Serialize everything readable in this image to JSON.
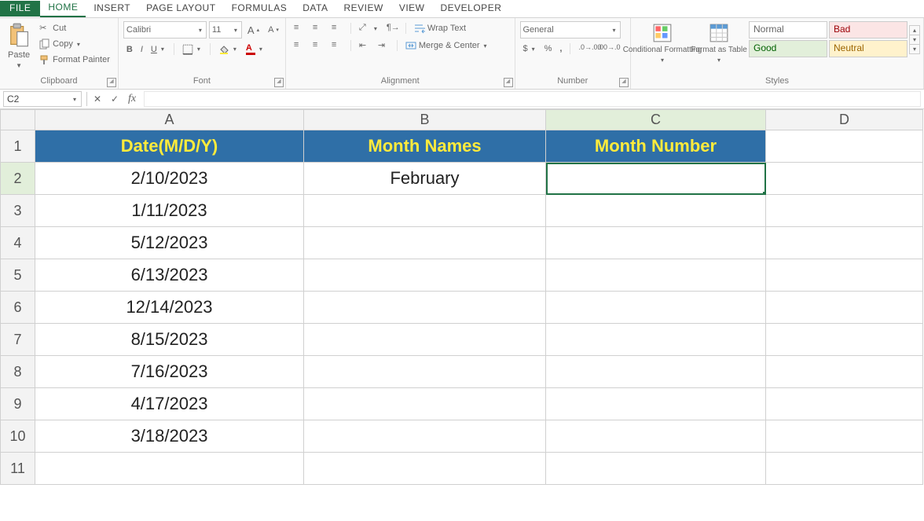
{
  "menu": {
    "file": "FILE",
    "home": "HOME",
    "insert": "INSERT",
    "page_layout": "PAGE LAYOUT",
    "formulas": "FORMULAS",
    "data": "DATA",
    "review": "REVIEW",
    "view": "VIEW",
    "developer": "DEVELOPER"
  },
  "ribbon": {
    "clipboard": {
      "paste": "Paste",
      "cut": "Cut",
      "copy": "Copy",
      "format_painter": "Format Painter",
      "label": "Clipboard"
    },
    "font": {
      "name": "Calibri",
      "size": "11",
      "label": "Font"
    },
    "alignment": {
      "wrap": "Wrap Text",
      "merge": "Merge & Center",
      "label": "Alignment"
    },
    "number": {
      "format": "General",
      "label": "Number"
    },
    "styles": {
      "conditional": "Conditional Formatting",
      "table": "Format as Table",
      "normal": "Normal",
      "bad": "Bad",
      "good": "Good",
      "neutral": "Neutral",
      "label": "Styles"
    }
  },
  "name_box": "C2",
  "formula": "",
  "columns": [
    "A",
    "B",
    "C",
    "D"
  ],
  "selection": {
    "row": 2,
    "col": "C"
  },
  "headers": {
    "A": "Date(M/D/Y)",
    "B": "Month Names",
    "C": "Month Number"
  },
  "rows": [
    {
      "A": "2/10/2023",
      "B": "February",
      "C": ""
    },
    {
      "A": "1/11/2023",
      "B": "",
      "C": ""
    },
    {
      "A": "5/12/2023",
      "B": "",
      "C": ""
    },
    {
      "A": "6/13/2023",
      "B": "",
      "C": ""
    },
    {
      "A": "12/14/2023",
      "B": "",
      "C": ""
    },
    {
      "A": "8/15/2023",
      "B": "",
      "C": ""
    },
    {
      "A": "7/16/2023",
      "B": "",
      "C": ""
    },
    {
      "A": "4/17/2023",
      "B": "",
      "C": ""
    },
    {
      "A": "3/18/2023",
      "B": "",
      "C": ""
    }
  ]
}
